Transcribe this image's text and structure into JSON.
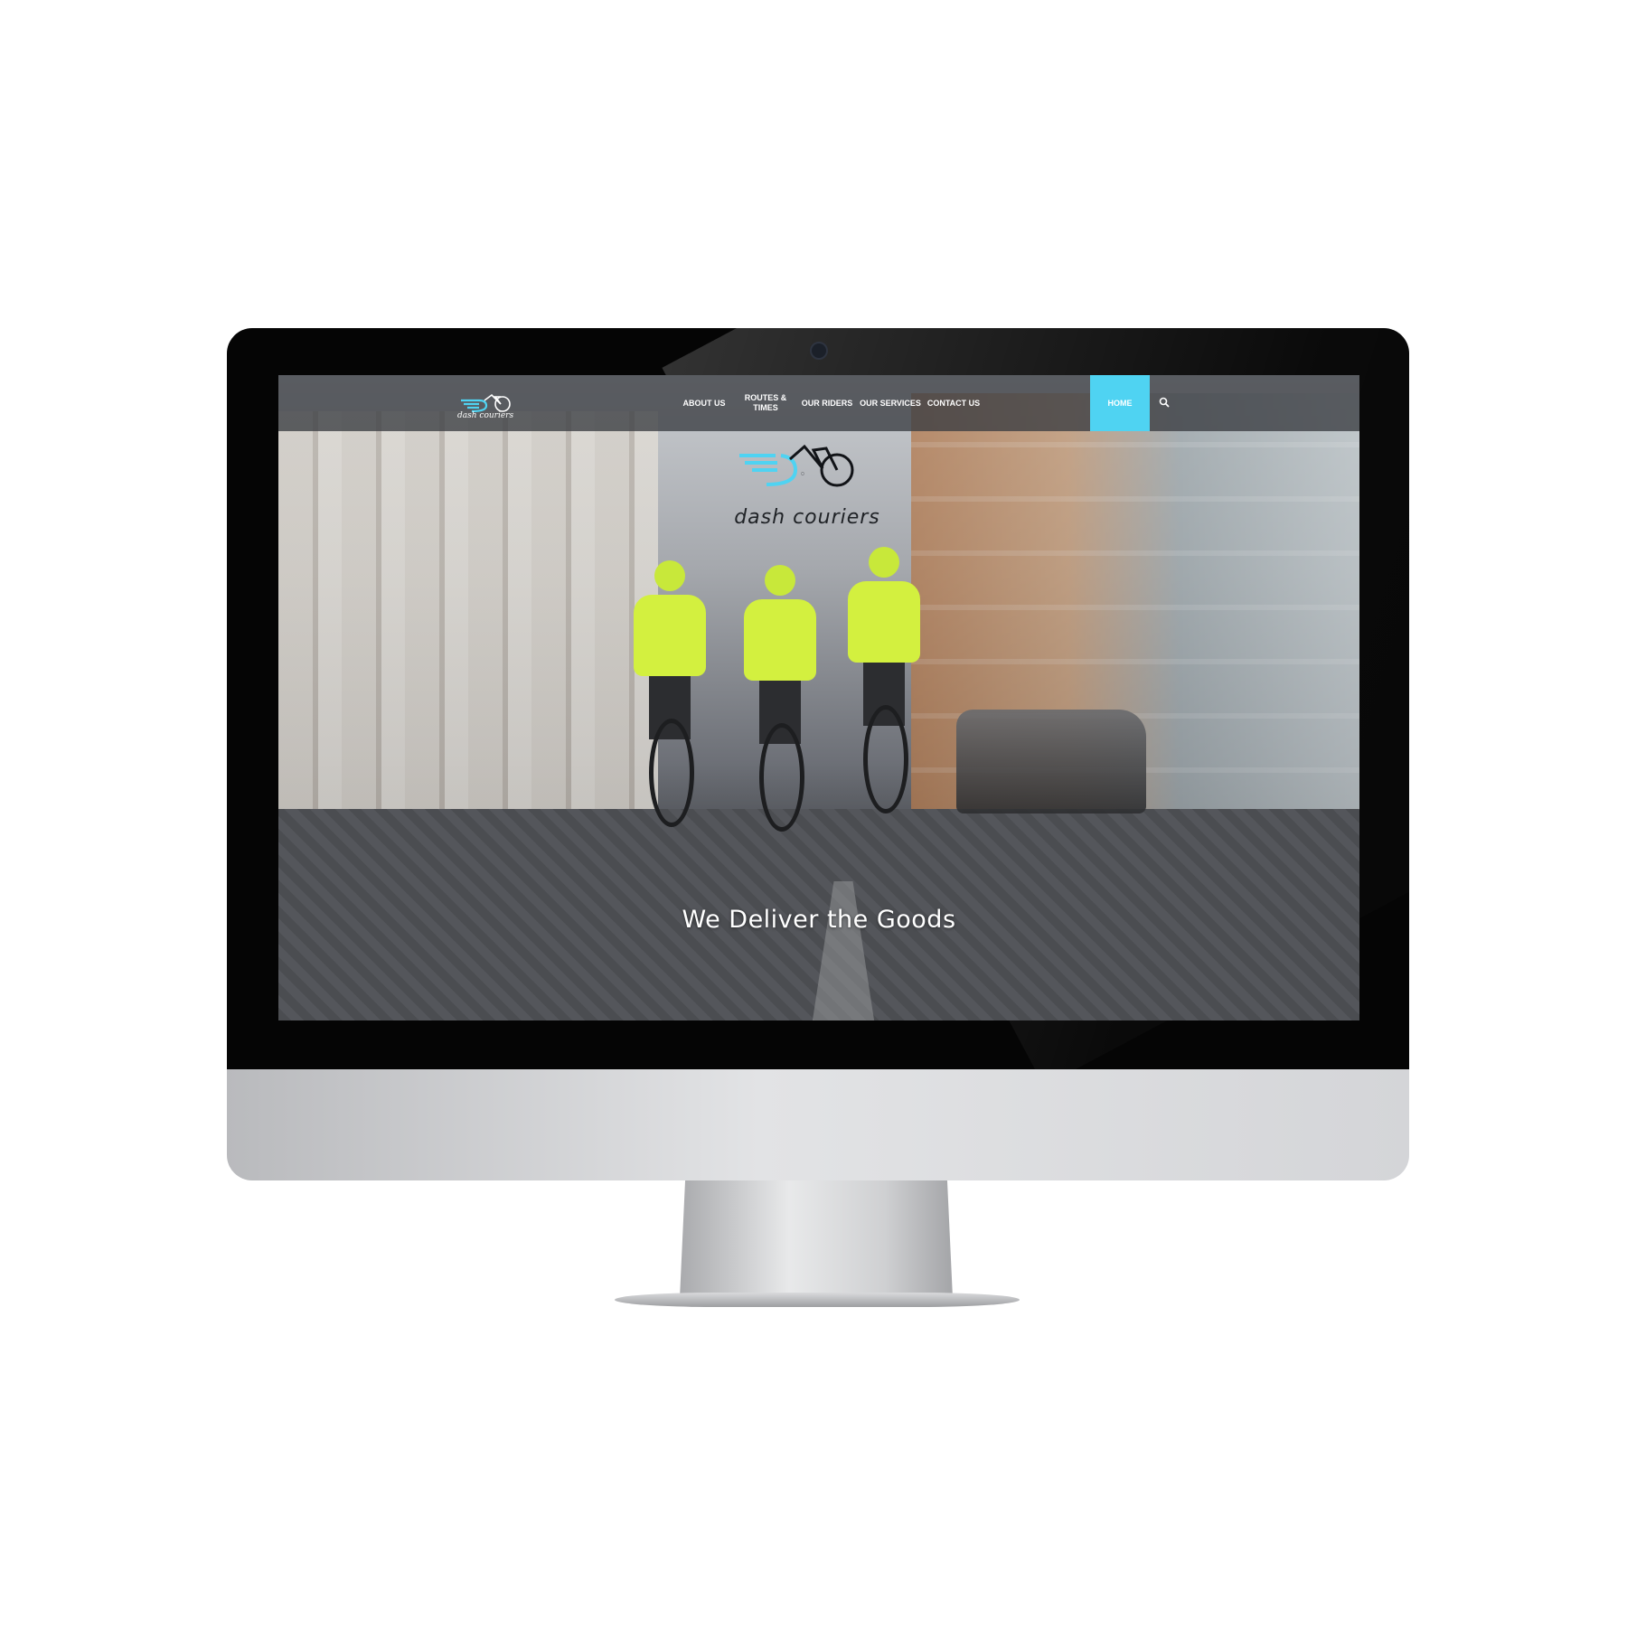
{
  "brand": {
    "name": "dash couriers",
    "accent_color": "#4fd3f2",
    "logo_icon": "bicycle-dash-logo"
  },
  "nav": {
    "items": [
      {
        "label": "ABOUT US"
      },
      {
        "label": "ROUTES & TIMES"
      },
      {
        "label": "OUR RIDERS"
      },
      {
        "label": "OUR SERVICES"
      },
      {
        "label": "CONTACT US"
      },
      {
        "label": "HOME",
        "active": true
      }
    ],
    "search_icon": "search-icon"
  },
  "hero": {
    "brand": "dash couriers",
    "tagline": "We Deliver the Goods"
  }
}
